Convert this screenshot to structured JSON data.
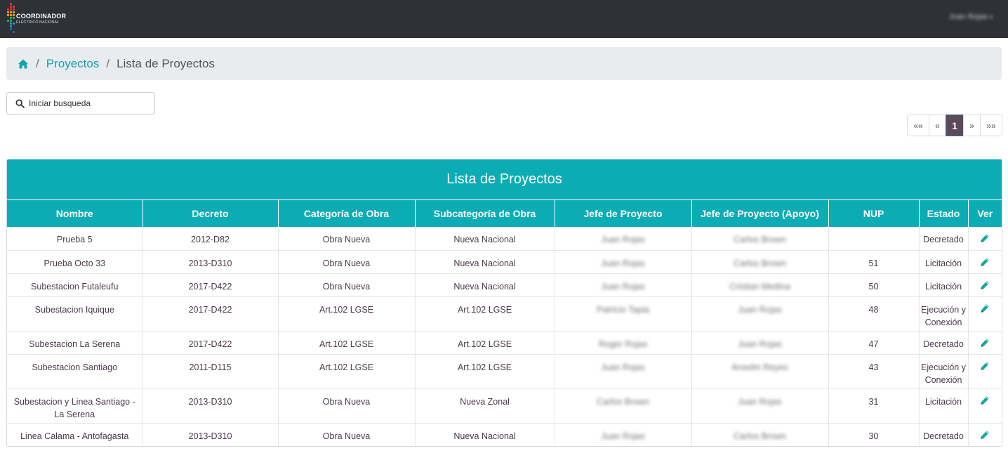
{
  "header": {
    "logo_line1": "COORDINADOR",
    "logo_line2": "ELÉCTRICO NACIONAL",
    "user_name": "Juan Rojas",
    "user_caret": "▾"
  },
  "breadcrumb": {
    "home_icon": "home-icon",
    "sep": "/",
    "link": "Proyectos",
    "active": "Lista de Proyectos"
  },
  "search": {
    "placeholder": "Iniciar busqueda",
    "value": ""
  },
  "pagination": {
    "first": "««",
    "prev": "«",
    "current": "1",
    "next": "»",
    "last": "»»"
  },
  "panel": {
    "title": "Lista de Proyectos"
  },
  "table": {
    "columns": [
      "Nombre",
      "Decreto",
      "Categoría de Obra",
      "Subcategoría de Obra",
      "Jefe de Proyecto",
      "Jefe de Proyecto (Apoyo)",
      "NUP",
      "Estado",
      "Ver"
    ],
    "rows": [
      {
        "nombre": "Prueba 5",
        "decreto": "2012-D82",
        "categoria": "Obra Nueva",
        "subcategoria": "Nueva Nacional",
        "jefe": "Juan Rojas",
        "apoyo": "Carlos Brown",
        "nup": "",
        "estado": "Decretado"
      },
      {
        "nombre": "Prueba Octo 33",
        "decreto": "2013-D310",
        "categoria": "Obra Nueva",
        "subcategoria": "Nueva Nacional",
        "jefe": "Juan Rojas",
        "apoyo": "Carlos Brown",
        "nup": "51",
        "estado": "Licitación"
      },
      {
        "nombre": "Subestacion Futaleufu",
        "decreto": "2017-D422",
        "categoria": "Obra Nueva",
        "subcategoria": "Nueva Nacional",
        "jefe": "Juan Rojas",
        "apoyo": "Cristian Medina",
        "nup": "50",
        "estado": "Licitación"
      },
      {
        "nombre": "Subestacion Iquique",
        "decreto": "2017-D422",
        "categoria": "Art.102 LGSE",
        "subcategoria": "Art.102 LGSE",
        "jefe": "Patricio Tapia",
        "apoyo": "Juan Rojas",
        "nup": "48",
        "estado": "Ejecución y Conexión"
      },
      {
        "nombre": "Subestacion La Serena",
        "decreto": "2017-D422",
        "categoria": "Art.102 LGSE",
        "subcategoria": "Art.102 LGSE",
        "jefe": "Roger Rojas",
        "apoyo": "Juan Rojas",
        "nup": "47",
        "estado": "Decretado"
      },
      {
        "nombre": "Subestacion Santiago",
        "decreto": "2011-D115",
        "categoria": "Art.102 LGSE",
        "subcategoria": "Art.102 LGSE",
        "jefe": "Juan Rojas",
        "apoyo": "Anselm Reyes",
        "nup": "43",
        "estado": "Ejecución y Conexión"
      },
      {
        "nombre": "Subestacion y Linea Santiago - La Serena",
        "decreto": "2013-D310",
        "categoria": "Obra Nueva",
        "subcategoria": "Nueva Zonal",
        "jefe": "Carlos Brown",
        "apoyo": "Juan Rojas",
        "nup": "31",
        "estado": "Licitación"
      },
      {
        "nombre": "Linea Calama - Antofagasta",
        "decreto": "2013-D310",
        "categoria": "Obra Nueva",
        "subcategoria": "Nueva Nacional",
        "jefe": "Juan Rojas",
        "apoyo": "Carlos Brown",
        "nup": "30",
        "estado": "Decretado"
      }
    ],
    "action_icon": "pencil-icon"
  },
  "colors": {
    "topbar": "#2f3136",
    "accent": "#0cacb4",
    "link": "#12a4ab",
    "pager_active": "#5a4a5a"
  }
}
